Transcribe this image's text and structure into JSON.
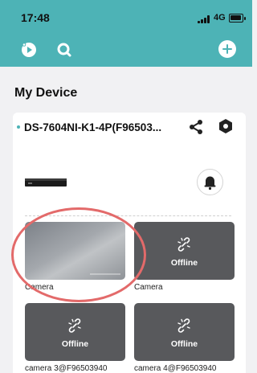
{
  "status_bar": {
    "time": "17:48",
    "network": "4G"
  },
  "toolbar": {
    "play_icon": "play-circle-icon",
    "search_icon": "search-icon",
    "add_icon": "plus-circle-icon"
  },
  "section": {
    "title": "My Device"
  },
  "device": {
    "name": "DS-7604NI-K1-4P(F96503...",
    "share_icon": "share-icon",
    "settings_icon": "gear-hexagon-icon",
    "alarm_icon": "bell-icon"
  },
  "cameras": [
    {
      "label": "Camera",
      "status": ""
    },
    {
      "label": "Camera",
      "status": "Offline"
    },
    {
      "label": "camera 3@F96503940",
      "status": "Offline"
    },
    {
      "label": "camera 4@F96503940",
      "status": "Offline"
    }
  ],
  "colors": {
    "header": "#4db3b6",
    "tile": "#58595c",
    "highlight": "#e36a6a",
    "background": "#f1f1f3"
  }
}
